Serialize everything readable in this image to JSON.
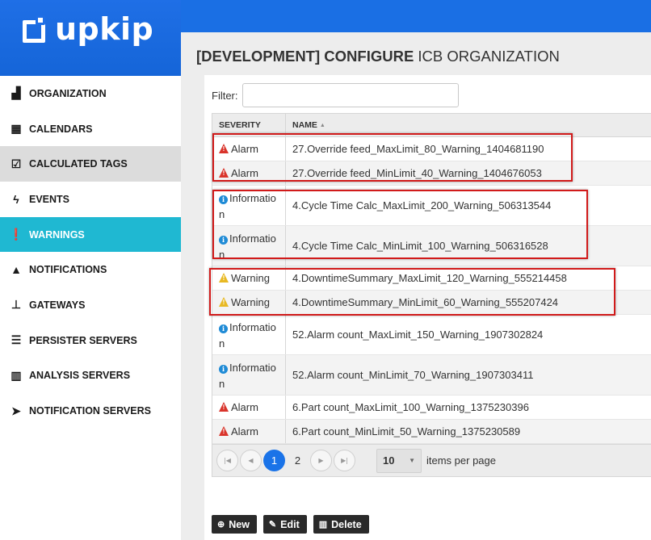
{
  "brand": {
    "name": "upkip"
  },
  "sidebar": {
    "items": [
      {
        "label": "ORGANIZATION",
        "icon": "factory-icon",
        "glyph": "▟",
        "state": "normal"
      },
      {
        "label": "CALENDARS",
        "icon": "calendar-icon",
        "glyph": "▦",
        "state": "normal"
      },
      {
        "label": "CALCULATED TAGS",
        "icon": "calendar-check-icon",
        "glyph": "☑",
        "state": "gray"
      },
      {
        "label": "EVENTS",
        "icon": "bolt-icon",
        "glyph": "ϟ",
        "state": "normal"
      },
      {
        "label": "WARNINGS",
        "icon": "exclamation-circle-icon",
        "glyph": "❗",
        "state": "active"
      },
      {
        "label": "NOTIFICATIONS",
        "icon": "bell-icon",
        "glyph": "▲",
        "state": "normal"
      },
      {
        "label": "GATEWAYS",
        "icon": "sitemap-icon",
        "glyph": "⊥",
        "state": "normal"
      },
      {
        "label": "PERSISTER SERVERS",
        "icon": "server-icon",
        "glyph": "☰",
        "state": "normal"
      },
      {
        "label": "ANALYSIS SERVERS",
        "icon": "bar-chart-icon",
        "glyph": "▥",
        "state": "normal"
      },
      {
        "label": "NOTIFICATION SERVERS",
        "icon": "paper-plane-icon",
        "glyph": "➤",
        "state": "normal"
      }
    ]
  },
  "header": {
    "title_bold": "[DEVELOPMENT] CONFIGURE",
    "title_rest": "ICB ORGANIZATION"
  },
  "filter": {
    "label": "Filter:",
    "value": ""
  },
  "grid": {
    "columns": {
      "severity": "SEVERITY",
      "name": "NAME",
      "sort_icon": "▲"
    },
    "rows": [
      {
        "severity": "Alarm",
        "name": "27.Override feed_MaxLimit_80_Warning_1404681190"
      },
      {
        "severity": "Alarm",
        "name": "27.Override feed_MinLimit_40_Warning_1404676053"
      },
      {
        "severity": "Information",
        "name": "4.Cycle Time Calc_MaxLimit_200_Warning_506313544"
      },
      {
        "severity": "Information",
        "name": "4.Cycle Time Calc_MinLimit_100_Warning_506316528"
      },
      {
        "severity": "Warning",
        "name": "4.DowntimeSummary_MaxLimit_120_Warning_555214458"
      },
      {
        "severity": "Warning",
        "name": "4.DowntimeSummary_MinLimit_60_Warning_555207424"
      },
      {
        "severity": "Information",
        "name": "52.Alarm count_MaxLimit_150_Warning_1907302824"
      },
      {
        "severity": "Information",
        "name": "52.Alarm count_MinLimit_70_Warning_1907303411"
      },
      {
        "severity": "Alarm",
        "name": "6.Part count_MaxLimit_100_Warning_1375230396"
      },
      {
        "severity": "Alarm",
        "name": "6.Part count_MinLimit_50_Warning_1375230589"
      }
    ]
  },
  "pager": {
    "pages": [
      "1",
      "2"
    ],
    "current_page": "1",
    "page_size": "10",
    "page_size_label": "items per page"
  },
  "actions": {
    "new": "New",
    "edit": "Edit",
    "delete": "Delete"
  },
  "colors": {
    "brand_blue": "#1a6fe4",
    "active_teal": "#1fb8d2",
    "alarm_red": "#d9342b",
    "warning_yellow": "#e8b923",
    "info_blue": "#1f8bd6",
    "highlight_red": "#d11a1a"
  }
}
